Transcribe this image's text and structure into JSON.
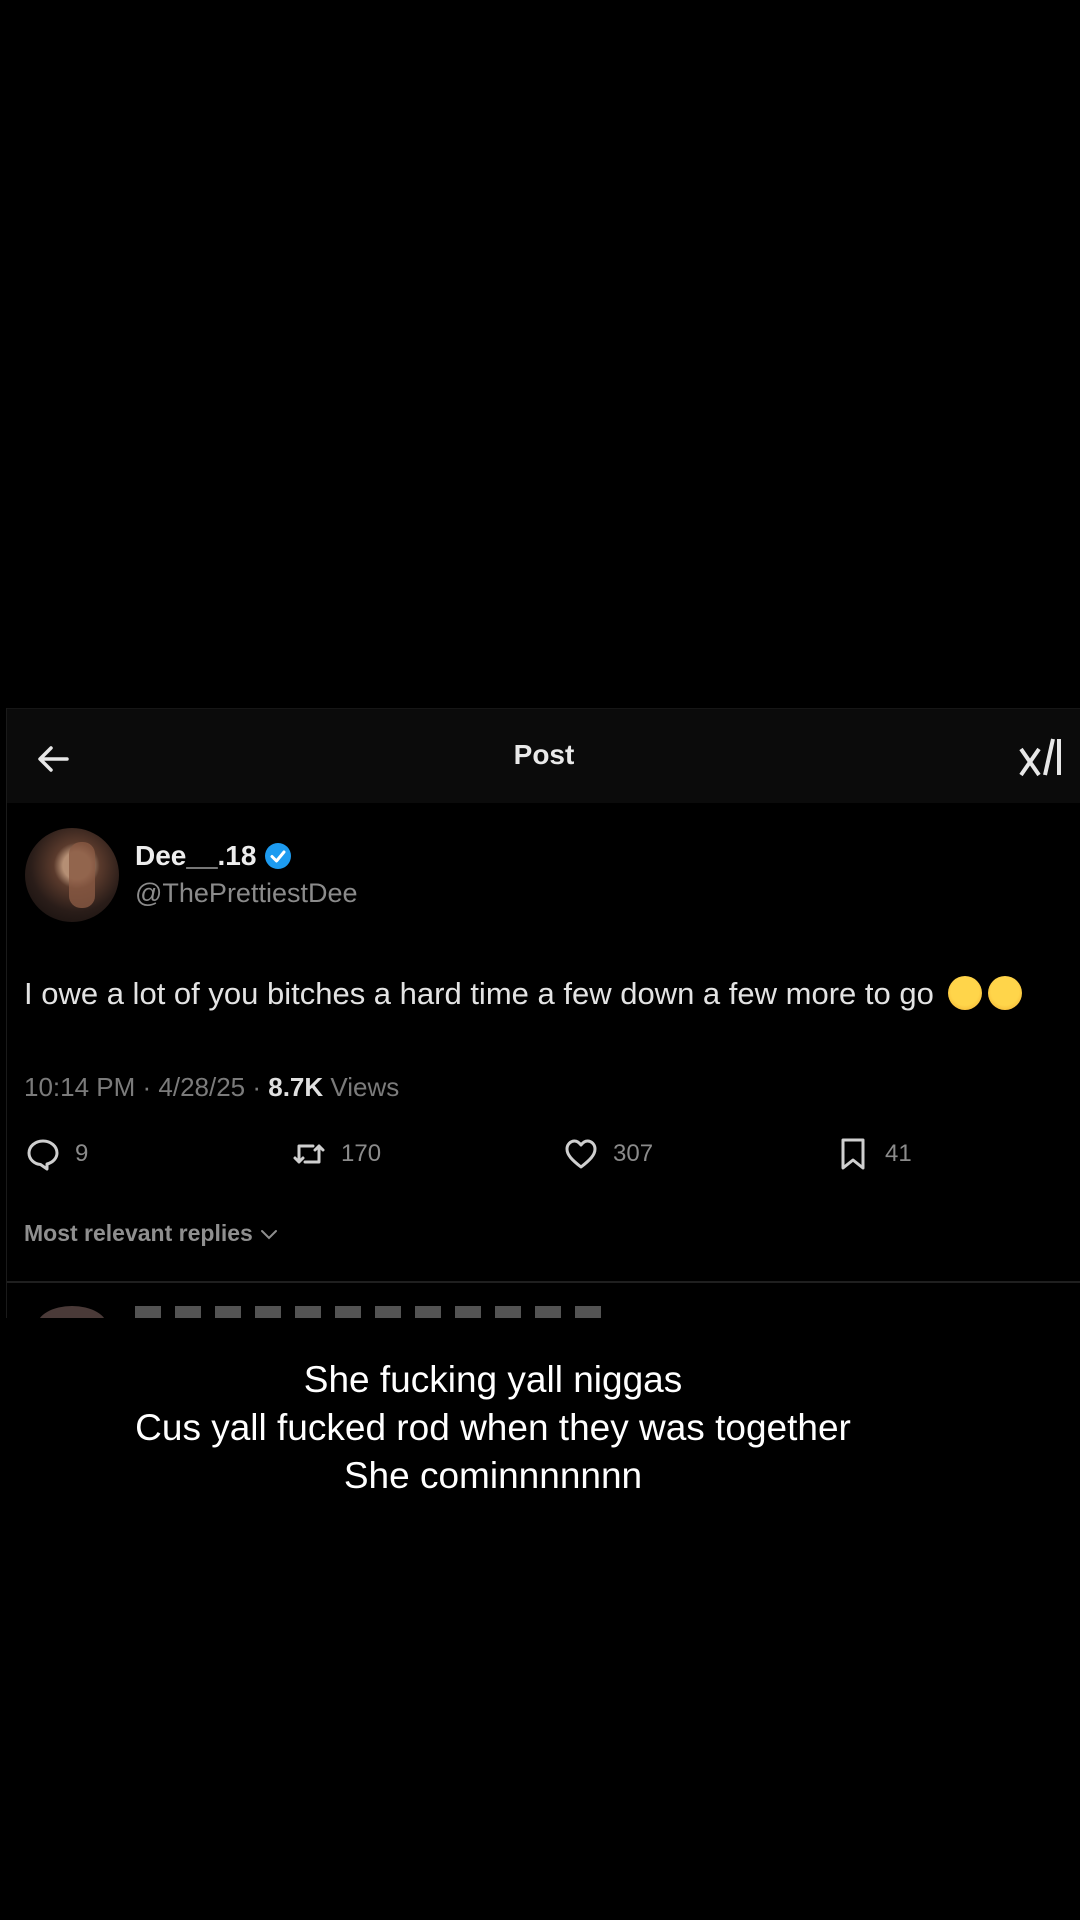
{
  "header": {
    "title": "Post"
  },
  "tweet": {
    "display_name": "Dee__.18",
    "handle": "@ThePrettiestDee",
    "text": "I owe a lot of you bitches a hard time a few down a few more to go",
    "time": "10:14 PM · 4/28/25 · ",
    "views_count": "8.7K",
    "views_label": " Views"
  },
  "actions": {
    "replies": "9",
    "reposts": "170",
    "likes": "307",
    "bookmarks": "41"
  },
  "replies_sort": {
    "label": "Most relevant replies"
  },
  "caption": {
    "line1": "She fucking yall niggas",
    "line2": "Cus yall fucked rod when they was together",
    "line3": "She cominnnnnnn"
  },
  "colors": {
    "verified": "#1d9bf0",
    "background": "#000000"
  },
  "icons": [
    "back-arrow-icon",
    "xai-logo-icon",
    "verified-badge-icon",
    "reply-icon",
    "repost-icon",
    "like-icon",
    "bookmark-icon",
    "chevron-down-icon"
  ]
}
